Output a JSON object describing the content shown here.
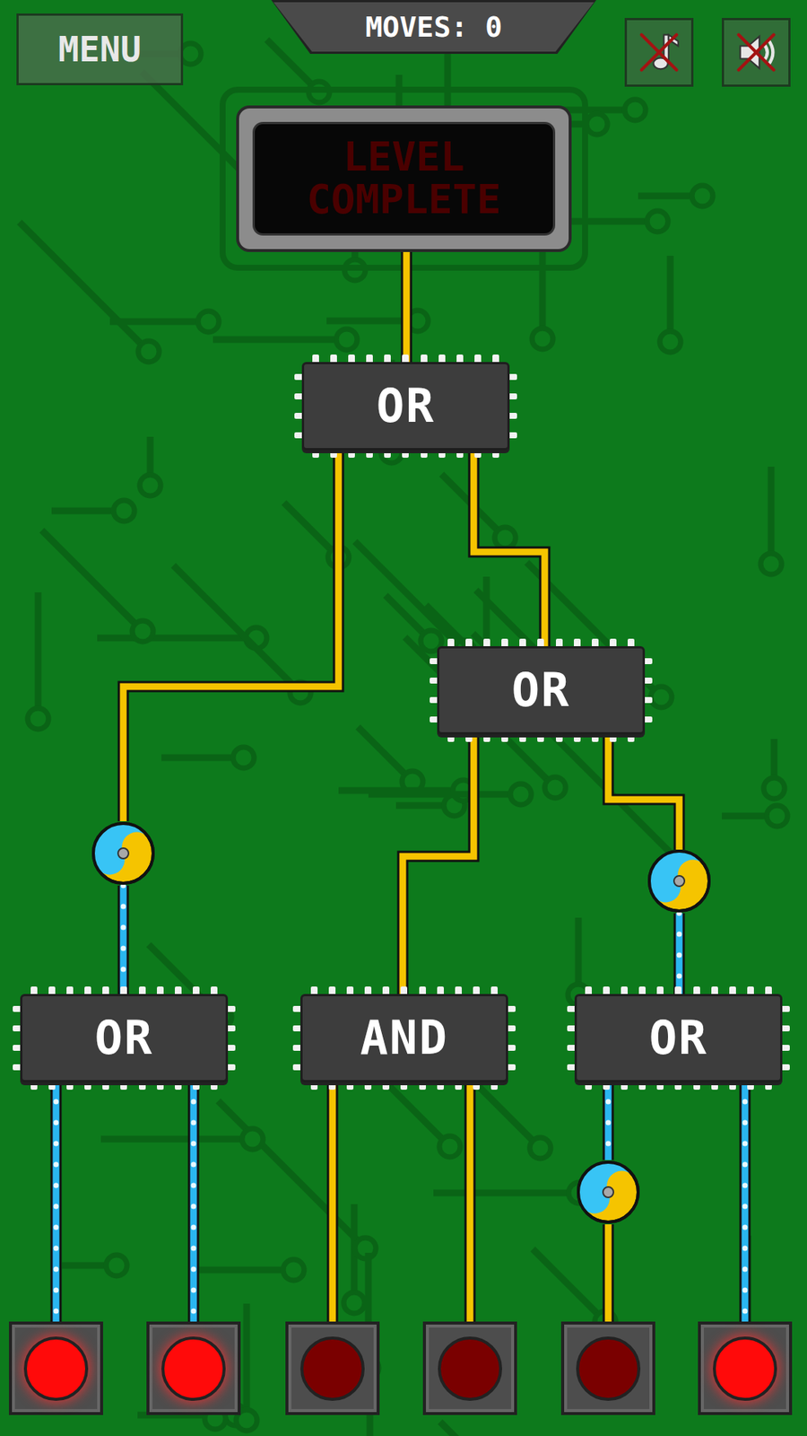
{
  "menu_button": {
    "label": "MENU"
  },
  "moves": {
    "label": "MOVES: 0"
  },
  "music": {
    "muted": true
  },
  "sound": {
    "muted": true
  },
  "display": {
    "text": "LEVEL COMPLETE",
    "lit": false
  },
  "gates": [
    {
      "label": "OR"
    },
    {
      "label": "OR"
    },
    {
      "label": "OR"
    },
    {
      "label": "AND"
    },
    {
      "label": "OR"
    }
  ],
  "wires": [
    {
      "on": false
    },
    {
      "on": false
    },
    {
      "on": true
    },
    {
      "on": false
    },
    {
      "on": false
    },
    {
      "on": false
    },
    {
      "on": true
    },
    {
      "on": true
    },
    {
      "on": true
    },
    {
      "on": false
    },
    {
      "on": false
    },
    {
      "on": false
    },
    {
      "on": true
    },
    {
      "on": true
    }
  ],
  "inverters": [
    {
      "active": true
    },
    {
      "active": true
    },
    {
      "active": true
    }
  ],
  "switches": [
    {
      "on": true
    },
    {
      "on": true
    },
    {
      "on": false
    },
    {
      "on": false
    },
    {
      "on": false
    },
    {
      "on": true
    }
  ]
}
